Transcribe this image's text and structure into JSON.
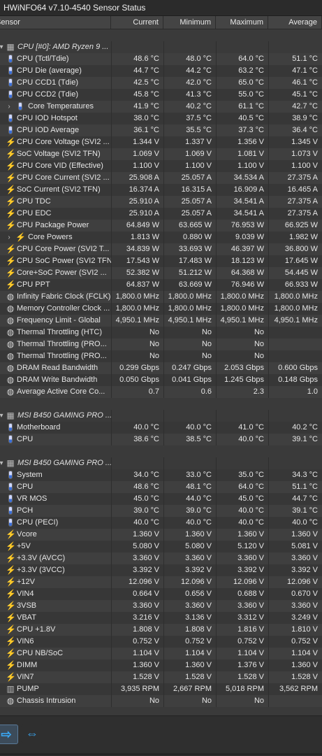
{
  "window": {
    "title": "HWiNFO64 v7.10-4540 Sensor Status"
  },
  "columns": {
    "sensor": "Sensor",
    "current": "Current",
    "minimum": "Minimum",
    "maximum": "Maximum",
    "average": "Average"
  },
  "rows": [
    {
      "type": "blank"
    },
    {
      "type": "group",
      "label": "CPU [#0]: AMD Ryzen 9 ...",
      "icon": "chip-icon"
    },
    {
      "type": "data",
      "icon": "temp",
      "label": "CPU (Tctl/Tdie)",
      "cur": "48.6 °C",
      "min": "48.0 °C",
      "max": "64.0 °C",
      "avg": "51.1 °C"
    },
    {
      "type": "data",
      "icon": "temp",
      "label": "CPU Die (average)",
      "cur": "44.7 °C",
      "min": "44.2 °C",
      "max": "63.2 °C",
      "avg": "47.1 °C"
    },
    {
      "type": "data",
      "icon": "temp",
      "label": "CPU CCD1 (Tdie)",
      "cur": "42.5 °C",
      "min": "42.0 °C",
      "max": "65.0 °C",
      "avg": "46.1 °C"
    },
    {
      "type": "data",
      "icon": "temp",
      "label": "CPU CCD2 (Tdie)",
      "cur": "45.8 °C",
      "min": "41.3 °C",
      "max": "55.0 °C",
      "avg": "45.1 °C"
    },
    {
      "type": "data",
      "icon": "temp",
      "expand": true,
      "label": "Core Temperatures",
      "cur": "41.9 °C",
      "min": "40.2 °C",
      "max": "61.1 °C",
      "avg": "42.7 °C"
    },
    {
      "type": "data",
      "icon": "temp",
      "label": "CPU IOD Hotspot",
      "cur": "38.0 °C",
      "min": "37.5 °C",
      "max": "40.5 °C",
      "avg": "38.9 °C"
    },
    {
      "type": "data",
      "icon": "temp",
      "label": "CPU IOD Average",
      "cur": "36.1 °C",
      "min": "35.5 °C",
      "max": "37.3 °C",
      "avg": "36.4 °C"
    },
    {
      "type": "data",
      "icon": "volt",
      "label": "CPU Core Voltage (SVI2 ...",
      "cur": "1.344 V",
      "min": "1.337 V",
      "max": "1.356 V",
      "avg": "1.345 V"
    },
    {
      "type": "data",
      "icon": "volt",
      "label": "SoC Voltage (SVI2 TFN)",
      "cur": "1.069 V",
      "min": "1.069 V",
      "max": "1.081 V",
      "avg": "1.073 V"
    },
    {
      "type": "data",
      "icon": "volt",
      "label": "CPU Core VID (Effective)",
      "cur": "1.100 V",
      "min": "1.100 V",
      "max": "1.100 V",
      "avg": "1.100 V"
    },
    {
      "type": "data",
      "icon": "volt",
      "label": "CPU Core Current (SVI2 ...",
      "cur": "25.908 A",
      "min": "25.057 A",
      "max": "34.534 A",
      "avg": "27.375 A"
    },
    {
      "type": "data",
      "icon": "volt",
      "label": "SoC Current (SVI2 TFN)",
      "cur": "16.374 A",
      "min": "16.315 A",
      "max": "16.909 A",
      "avg": "16.465 A"
    },
    {
      "type": "data",
      "icon": "volt",
      "label": "CPU TDC",
      "cur": "25.910 A",
      "min": "25.057 A",
      "max": "34.541 A",
      "avg": "27.375 A"
    },
    {
      "type": "data",
      "icon": "volt",
      "label": "CPU EDC",
      "cur": "25.910 A",
      "min": "25.057 A",
      "max": "34.541 A",
      "avg": "27.375 A"
    },
    {
      "type": "data",
      "icon": "volt",
      "label": "CPU Package Power",
      "cur": "64.849 W",
      "min": "63.665 W",
      "max": "76.953 W",
      "avg": "66.925 W"
    },
    {
      "type": "data",
      "icon": "volt",
      "expand": true,
      "label": "Core Powers",
      "cur": "1.813 W",
      "min": "0.880 W",
      "max": "9.039 W",
      "avg": "1.982 W"
    },
    {
      "type": "data",
      "icon": "volt",
      "label": "CPU Core Power (SVI2 T...",
      "cur": "34.839 W",
      "min": "33.693 W",
      "max": "46.397 W",
      "avg": "36.800 W"
    },
    {
      "type": "data",
      "icon": "volt",
      "label": "CPU SoC Power (SVI2 TFN)",
      "cur": "17.543 W",
      "min": "17.483 W",
      "max": "18.123 W",
      "avg": "17.645 W"
    },
    {
      "type": "data",
      "icon": "volt",
      "label": "Core+SoC Power (SVI2 ...",
      "cur": "52.382 W",
      "min": "51.212 W",
      "max": "64.368 W",
      "avg": "54.445 W"
    },
    {
      "type": "data",
      "icon": "volt",
      "label": "CPU PPT",
      "cur": "64.837 W",
      "min": "63.669 W",
      "max": "76.946 W",
      "avg": "66.933 W"
    },
    {
      "type": "data",
      "icon": "clock",
      "label": "Infinity Fabric Clock (FCLK)",
      "cur": "1,800.0 MHz",
      "min": "1,800.0 MHz",
      "max": "1,800.0 MHz",
      "avg": "1,800.0 MHz"
    },
    {
      "type": "data",
      "icon": "clock",
      "label": "Memory Controller Clock ...",
      "cur": "1,800.0 MHz",
      "min": "1,800.0 MHz",
      "max": "1,800.0 MHz",
      "avg": "1,800.0 MHz"
    },
    {
      "type": "data",
      "icon": "clock",
      "label": "Frequency Limit - Global",
      "cur": "4,950.1 MHz",
      "min": "4,950.1 MHz",
      "max": "4,950.1 MHz",
      "avg": "4,950.1 MHz"
    },
    {
      "type": "data",
      "icon": "clock",
      "label": "Thermal Throttling (HTC)",
      "cur": "No",
      "min": "No",
      "max": "No",
      "avg": ""
    },
    {
      "type": "data",
      "icon": "clock",
      "label": "Thermal Throttling (PRO...",
      "cur": "No",
      "min": "No",
      "max": "No",
      "avg": ""
    },
    {
      "type": "data",
      "icon": "clock",
      "label": "Thermal Throttling (PRO...",
      "cur": "No",
      "min": "No",
      "max": "No",
      "avg": ""
    },
    {
      "type": "data",
      "icon": "clock",
      "label": "DRAM Read Bandwidth",
      "cur": "0.299 Gbps",
      "min": "0.247 Gbps",
      "max": "2.053 Gbps",
      "avg": "0.600 Gbps"
    },
    {
      "type": "data",
      "icon": "clock",
      "label": "DRAM Write Bandwidth",
      "cur": "0.050 Gbps",
      "min": "0.041 Gbps",
      "max": "1.245 Gbps",
      "avg": "0.148 Gbps"
    },
    {
      "type": "data",
      "icon": "clock",
      "label": "Average Active Core Co...",
      "cur": "0.7",
      "min": "0.6",
      "max": "2.3",
      "avg": "1.0"
    },
    {
      "type": "blank"
    },
    {
      "type": "group",
      "label": "MSI B450 GAMING PRO ...",
      "icon": "chip-icon"
    },
    {
      "type": "data",
      "icon": "temp",
      "label": "Motherboard",
      "cur": "40.0 °C",
      "min": "40.0 °C",
      "max": "41.0 °C",
      "avg": "40.2 °C"
    },
    {
      "type": "data",
      "icon": "temp",
      "label": "CPU",
      "cur": "38.6 °C",
      "min": "38.5 °C",
      "max": "40.0 °C",
      "avg": "39.1 °C"
    },
    {
      "type": "blank"
    },
    {
      "type": "group",
      "label": "MSI B450 GAMING PRO ...",
      "icon": "chip-icon"
    },
    {
      "type": "data",
      "icon": "temp",
      "label": "System",
      "cur": "34.0 °C",
      "min": "33.0 °C",
      "max": "35.0 °C",
      "avg": "34.3 °C"
    },
    {
      "type": "data",
      "icon": "temp",
      "label": "CPU",
      "cur": "48.6 °C",
      "min": "48.1 °C",
      "max": "64.0 °C",
      "avg": "51.1 °C"
    },
    {
      "type": "data",
      "icon": "temp",
      "label": "VR MOS",
      "cur": "45.0 °C",
      "min": "44.0 °C",
      "max": "45.0 °C",
      "avg": "44.7 °C"
    },
    {
      "type": "data",
      "icon": "temp",
      "label": "PCH",
      "cur": "39.0 °C",
      "min": "39.0 °C",
      "max": "40.0 °C",
      "avg": "39.1 °C"
    },
    {
      "type": "data",
      "icon": "temp",
      "label": "CPU (PECI)",
      "cur": "40.0 °C",
      "min": "40.0 °C",
      "max": "40.0 °C",
      "avg": "40.0 °C"
    },
    {
      "type": "data",
      "icon": "volt",
      "label": "Vcore",
      "cur": "1.360 V",
      "min": "1.360 V",
      "max": "1.360 V",
      "avg": "1.360 V"
    },
    {
      "type": "data",
      "icon": "volt",
      "label": "+5V",
      "cur": "5.080 V",
      "min": "5.080 V",
      "max": "5.120 V",
      "avg": "5.081 V"
    },
    {
      "type": "data",
      "icon": "volt",
      "label": "+3.3V (AVCC)",
      "cur": "3.360 V",
      "min": "3.360 V",
      "max": "3.360 V",
      "avg": "3.360 V"
    },
    {
      "type": "data",
      "icon": "volt",
      "label": "+3.3V (3VCC)",
      "cur": "3.392 V",
      "min": "3.392 V",
      "max": "3.392 V",
      "avg": "3.392 V"
    },
    {
      "type": "data",
      "icon": "volt",
      "label": "+12V",
      "cur": "12.096 V",
      "min": "12.096 V",
      "max": "12.096 V",
      "avg": "12.096 V"
    },
    {
      "type": "data",
      "icon": "volt",
      "label": "VIN4",
      "cur": "0.664 V",
      "min": "0.656 V",
      "max": "0.688 V",
      "avg": "0.670 V"
    },
    {
      "type": "data",
      "icon": "volt",
      "label": "3VSB",
      "cur": "3.360 V",
      "min": "3.360 V",
      "max": "3.360 V",
      "avg": "3.360 V"
    },
    {
      "type": "data",
      "icon": "volt",
      "label": "VBAT",
      "cur": "3.216 V",
      "min": "3.136 V",
      "max": "3.312 V",
      "avg": "3.249 V"
    },
    {
      "type": "data",
      "icon": "volt",
      "label": "CPU +1.8V",
      "cur": "1.808 V",
      "min": "1.808 V",
      "max": "1.816 V",
      "avg": "1.810 V"
    },
    {
      "type": "data",
      "icon": "volt",
      "label": "VIN6",
      "cur": "0.752 V",
      "min": "0.752 V",
      "max": "0.752 V",
      "avg": "0.752 V"
    },
    {
      "type": "data",
      "icon": "volt",
      "label": "CPU NB/SoC",
      "cur": "1.104 V",
      "min": "1.104 V",
      "max": "1.104 V",
      "avg": "1.104 V"
    },
    {
      "type": "data",
      "icon": "volt",
      "label": "DIMM",
      "cur": "1.360 V",
      "min": "1.360 V",
      "max": "1.376 V",
      "avg": "1.360 V"
    },
    {
      "type": "data",
      "icon": "volt",
      "label": "VIN7",
      "cur": "1.528 V",
      "min": "1.528 V",
      "max": "1.528 V",
      "avg": "1.528 V"
    },
    {
      "type": "data",
      "icon": "fan",
      "label": "PUMP",
      "cur": "3,935 RPM",
      "min": "2,667 RPM",
      "max": "5,018 RPM",
      "avg": "3,562 RPM"
    },
    {
      "type": "data",
      "icon": "clock",
      "label": "Chassis Intrusion",
      "cur": "No",
      "min": "No",
      "max": "No",
      "avg": ""
    }
  ],
  "footer": {
    "buttons": [
      {
        "icon": "arrow-right-icon"
      },
      {
        "icon": "expand-collapse-icon"
      }
    ]
  }
}
